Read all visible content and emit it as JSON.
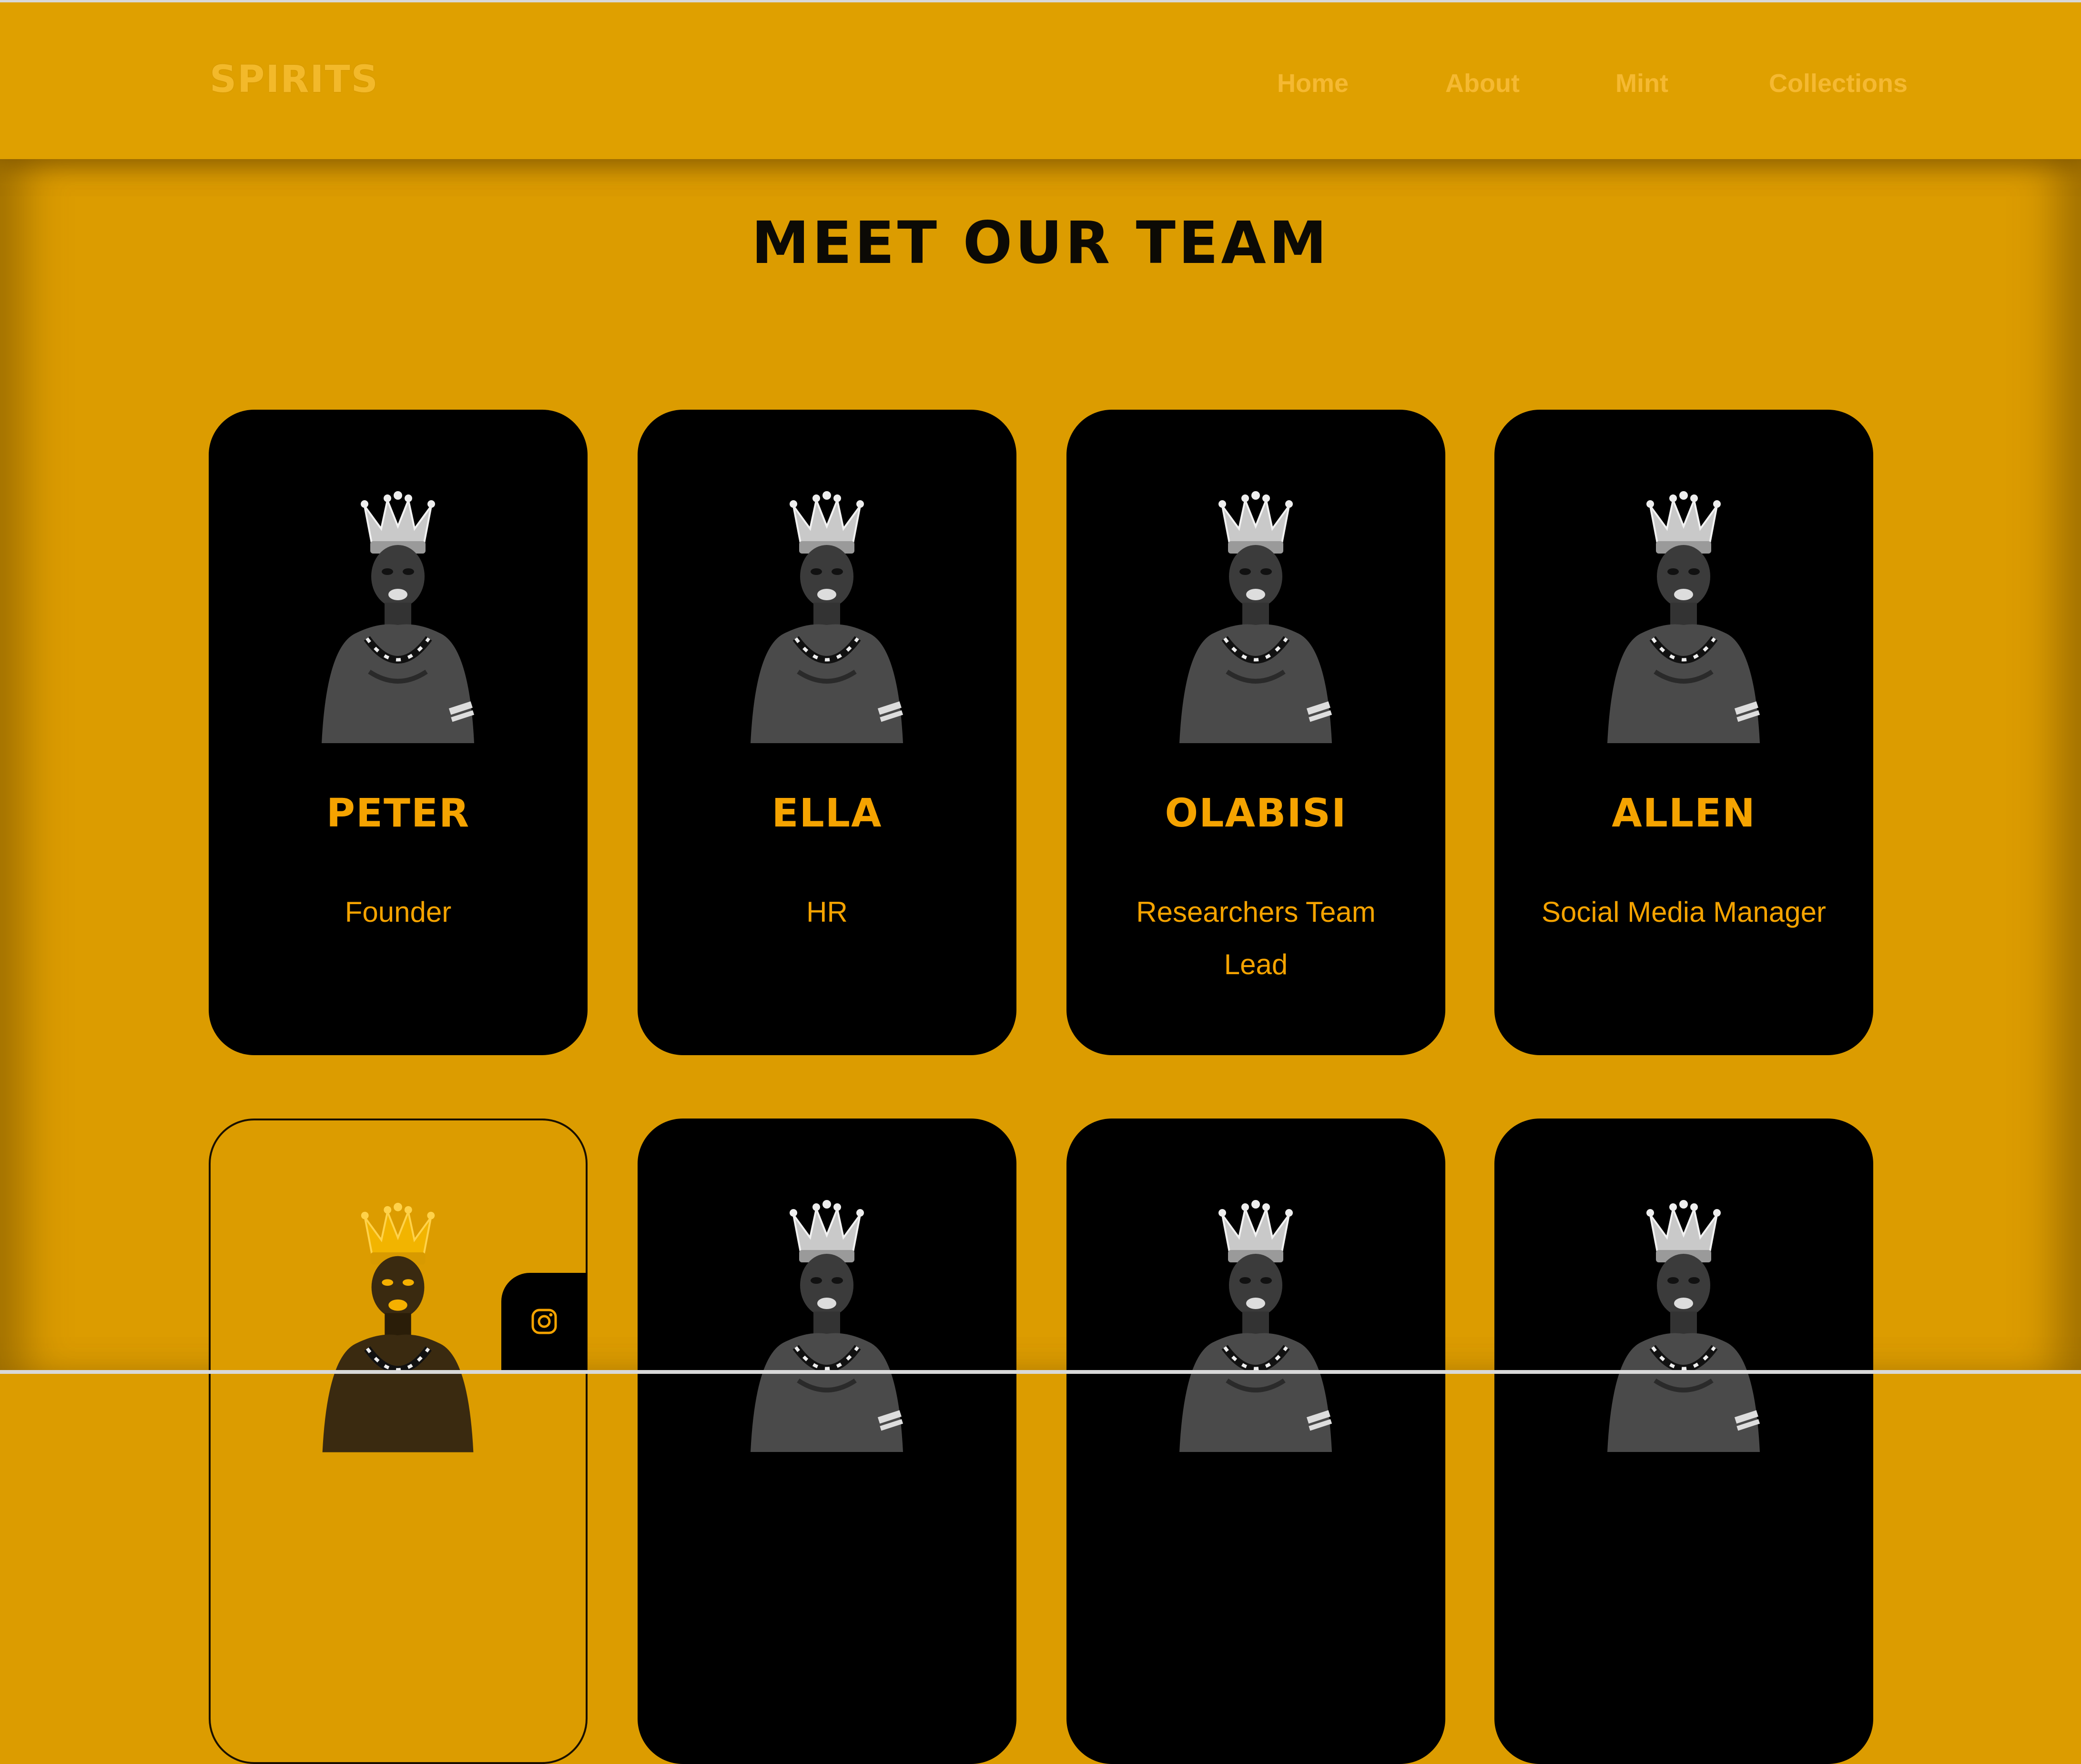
{
  "nav": {
    "logo": "SPIRITS",
    "links": [
      "Home",
      "About",
      "Mint",
      "Collections"
    ]
  },
  "heading": "MEET OUR TEAM",
  "team": [
    {
      "name": "PETER",
      "role": "Founder"
    },
    {
      "name": "ELLA",
      "role": "HR"
    },
    {
      "name": "OLABISI",
      "role": "Researchers Team Lead"
    },
    {
      "name": "ALLEN",
      "role": "Social Media Manager"
    }
  ],
  "colors": {
    "background": "#dc9c00",
    "card": "#000000",
    "accent": "#f5a300",
    "nav_text": "#f5b932"
  },
  "icons": {
    "social": "instagram-icon"
  }
}
